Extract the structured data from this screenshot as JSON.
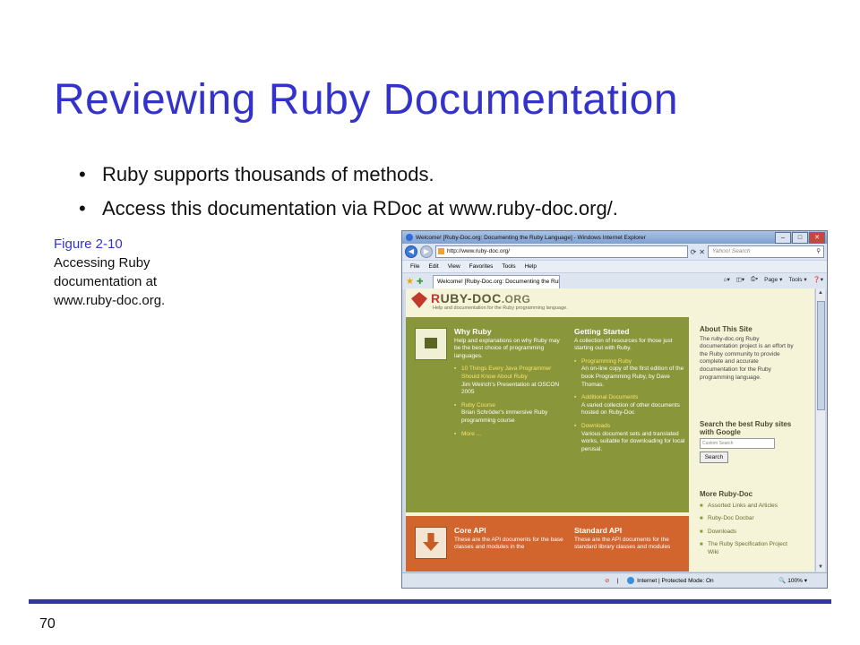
{
  "slide": {
    "title": "Reviewing Ruby Documentation",
    "bullets": [
      "Ruby supports thousands of methods.",
      "Access this documentation via RDoc at www.ruby-doc.org/."
    ],
    "caption_figure": "Figure 2-10",
    "caption_text": "Accessing Ruby documentation at www.ruby-doc.org.",
    "page_number": "70",
    "colors": {
      "title": "#3333cc",
      "footer_bar": "#3333aa"
    }
  },
  "browser": {
    "window_title": "Welcome! [Ruby-Doc.org: Documenting the Ruby Language] - Windows Internet Explorer",
    "address": "http://www.ruby-doc.org/",
    "search_placeholder": "Yahoo! Search",
    "menu": [
      "File",
      "Edit",
      "View",
      "Favorites",
      "Tools",
      "Help"
    ],
    "tab_title": "Welcome! [Ruby-Doc.org: Documenting the Rub...",
    "cmd_page": "Page",
    "cmd_tools": "Tools",
    "status_zone": "Internet | Protected Mode: On",
    "status_zoom": "100%"
  },
  "site": {
    "logo_r": "R",
    "logo_rest": "UBY-DOC",
    "logo_org": ".ORG",
    "tagline": "Help and documentation for the Ruby programming language.",
    "why_ruby": {
      "title": "Why Ruby",
      "desc": "Help and explanations on why Ruby may be the best choice of programming languages.",
      "items": [
        {
          "link": "10 Things Every Java Programmer Should Know About Ruby",
          "desc": "Jim Weirich's Presentation at OSCON 2005"
        },
        {
          "link": "Ruby Course",
          "desc": "Brian Schröder's immersive Ruby programming course"
        },
        {
          "link": "More ...",
          "desc": ""
        }
      ]
    },
    "getting_started": {
      "title": "Getting Started",
      "desc": "A collection of resources for those just starting out with Ruby.",
      "items": [
        {
          "link": "Programming Ruby",
          "desc": "An on-line copy of the first edition of the book Programming Ruby, by Dave Thomas."
        },
        {
          "link": "Additional Documents",
          "desc": "A varied collection of other documents hosted on Ruby-Doc"
        },
        {
          "link": "Downloads",
          "desc": "Various document sets and translated works, suitable for downloading for local perusal."
        }
      ]
    },
    "core_api": {
      "title": "Core API",
      "desc": "These are the API documents for the base classes and modules in the"
    },
    "standard_api": {
      "title": "Standard API",
      "desc": "These are the API documents for the standard library classes and modules"
    },
    "sidebar": {
      "about_title": "About This Site",
      "about_text": "The ruby-doc.org Ruby documentation project is an effort by the Ruby community to provide complete and accurate documentation for the Ruby programming language.",
      "search_title": "Search the best Ruby sites with Google",
      "search_placeholder": "Custom Search",
      "search_button": "Search",
      "more_title": "More Ruby-Doc",
      "more_links": [
        "Assorted Links and Articles",
        "Ruby-Doc Docbar",
        "Downloads",
        "The Ruby Specification Project Wiki"
      ]
    },
    "colors": {
      "green_panel": "#8a963a",
      "orange_panel": "#d2642d",
      "link_yellow": "#f7e46a",
      "logo_red": "#c0392b"
    }
  }
}
